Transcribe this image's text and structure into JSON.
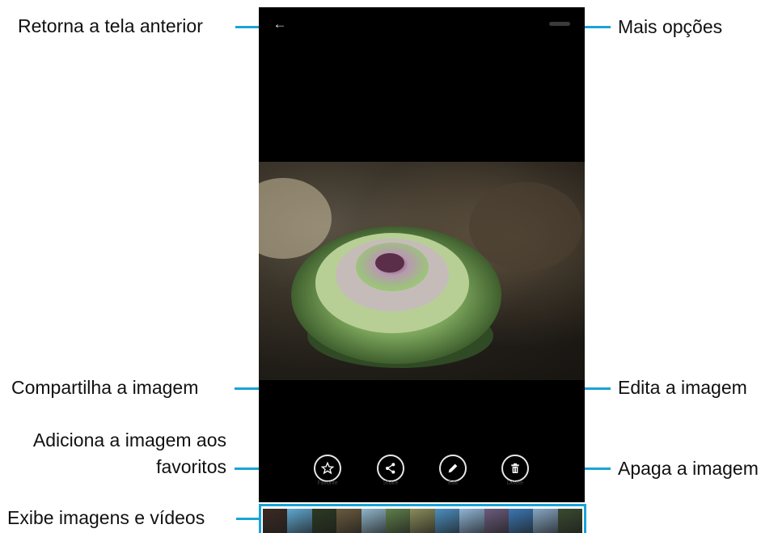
{
  "annotations": {
    "back": "Retorna a tela anterior",
    "more": "Mais opções",
    "share": "Compartilha a imagem",
    "edit": "Edita a imagem",
    "favorite_line1": "Adiciona a imagem aos",
    "favorite_line2": "favoritos",
    "delete": "Apaga a imagem",
    "thumbnails": "Exibe imagens e vídeos"
  },
  "screen": {
    "back_icon": "arrow-left-icon",
    "more_icon": "more-options-icon",
    "actions": [
      {
        "icon": "star-icon",
        "caption": "Favorite"
      },
      {
        "icon": "share-icon",
        "caption": "Share"
      },
      {
        "icon": "pencil-icon",
        "caption": "Edit"
      },
      {
        "icon": "trash-icon",
        "caption": "Delete"
      }
    ]
  },
  "thumbnails": [
    "#3b2a22",
    "#5fa7cf",
    "#2c3a22",
    "#6a5a3d",
    "#8fb5c9",
    "#5f7f4a",
    "#8a8c5a",
    "#4c8fc0",
    "#8fb5d6",
    "#6b5b7d",
    "#3b77b3",
    "#86a6c2",
    "#3a4a2f"
  ],
  "colors": {
    "accent": "#1aa3d6"
  }
}
